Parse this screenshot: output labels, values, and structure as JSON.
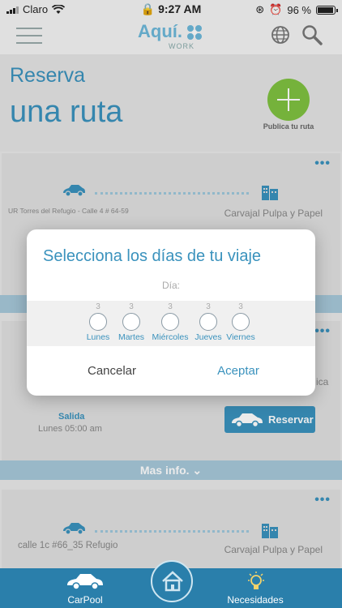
{
  "status_bar": {
    "carrier": "Claro",
    "time": "9:27 AM",
    "battery": "96 %",
    "battery_level": 0.96
  },
  "header": {
    "logo_text": "Aquí.",
    "logo_sub": "WORK"
  },
  "page": {
    "title_line1": "Reserva",
    "title_line2": "una ruta",
    "publish_label": "Publica tu ruta"
  },
  "cards": [
    {
      "origin": "UR Torres del Refugio - Calle 4 # 64-59",
      "destination": "Carvajal Pulpa y Papel"
    },
    {
      "peek_text": "ica",
      "departure_label": "Salida",
      "departure_time": "Lunes 05:00 am",
      "reserve_label": "Reservar",
      "more_info": "Mas info. ⌄"
    },
    {
      "origin": "calle 1c #66_35 Refugio",
      "destination": "Carvajal Pulpa y Papel"
    }
  ],
  "modal": {
    "title": "Selecciona los días de tu viaje",
    "day_label": "Día:",
    "days": [
      {
        "count": "3",
        "name": "Lunes"
      },
      {
        "count": "3",
        "name": "Martes"
      },
      {
        "count": "3",
        "name": "Miércoles"
      },
      {
        "count": "3",
        "name": "Jueves"
      },
      {
        "count": "3",
        "name": "Viernes"
      }
    ],
    "cancel": "Cancelar",
    "accept": "Aceptar"
  },
  "bottom_nav": {
    "items": [
      {
        "label": "CarPool",
        "icon": "car-icon"
      },
      {
        "label": "Necesidades",
        "icon": "lightbulb-icon"
      }
    ],
    "home_icon": "home-icon"
  },
  "colors": {
    "accent": "#3a92bd",
    "publish_green": "#7fc241",
    "nav_bg": "#2a7fab"
  }
}
